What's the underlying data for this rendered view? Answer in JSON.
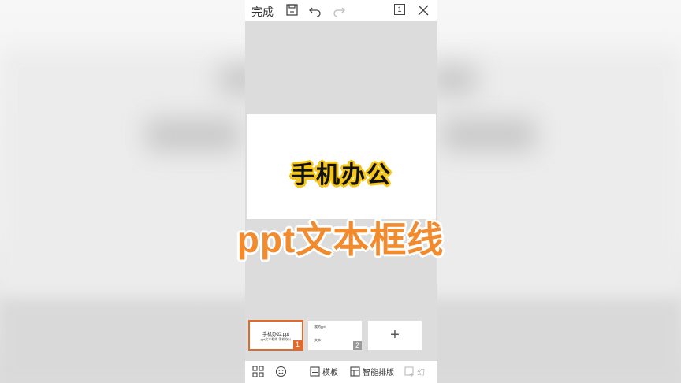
{
  "topbar": {
    "done_label": "完成",
    "page_count": "1"
  },
  "slide": {
    "title": "手机办公"
  },
  "overlay": {
    "caption": "ppt文本框线"
  },
  "thumbnails": [
    {
      "number": "1",
      "title": "手机办公.ppt",
      "subtitle": "ppt文本框线 手机办公",
      "selected": true
    },
    {
      "number": "2",
      "line_a": "我的ppt",
      "line_b": "文本",
      "selected": false
    }
  ],
  "add_slide": {
    "symbol": "+"
  },
  "bottombar": {
    "template_label": "模板",
    "smart_layout_label": "智能排版",
    "insert_label": "幻"
  },
  "colors": {
    "accent": "#e06a2c",
    "title_outline": "#f5c518",
    "caption": "#f28b2e"
  }
}
